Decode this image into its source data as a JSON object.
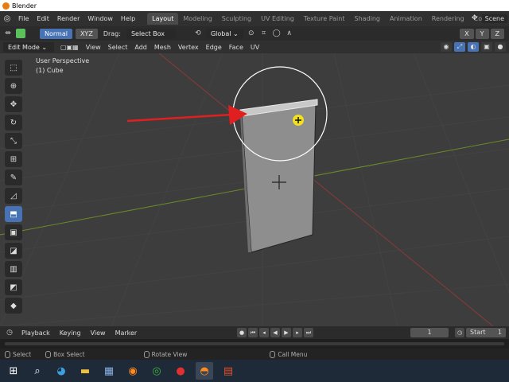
{
  "window": {
    "title": "Blender"
  },
  "menu": [
    "File",
    "Edit",
    "Render",
    "Window",
    "Help"
  ],
  "workspaces": [
    "Layout",
    "Modeling",
    "Sculpting",
    "UV Editing",
    "Texture Paint",
    "Shading",
    "Animation",
    "Rendering",
    "Compo"
  ],
  "scene_label": "Scene",
  "toolbar": {
    "orientation_normal": "Normal",
    "xyz": "XYZ",
    "drag_label": "Drag:",
    "select_box": "Select Box",
    "transform_global": "Global",
    "axis_x": "X",
    "axis_y": "Y",
    "axis_z": "Z"
  },
  "view_header": {
    "mode": "Edit Mode",
    "items": [
      "View",
      "Select",
      "Add",
      "Mesh",
      "Vertex",
      "Edge",
      "Face",
      "UV"
    ]
  },
  "viewport": {
    "perspective": "User Perspective",
    "object": "(1) Cube"
  },
  "timeline": {
    "items": [
      "Playback",
      "Keying",
      "View",
      "Marker"
    ],
    "current_frame": "1",
    "start_label": "Start",
    "start_value": "1"
  },
  "status": {
    "select": "Select",
    "box_select": "Box Select",
    "rotate_view": "Rotate View",
    "call_menu": "Call Menu"
  },
  "colors": {
    "accent": "#4772b3",
    "workspace_active": "#4a4a4a",
    "arrow": "#e02020",
    "cursor": "#f0e020"
  }
}
